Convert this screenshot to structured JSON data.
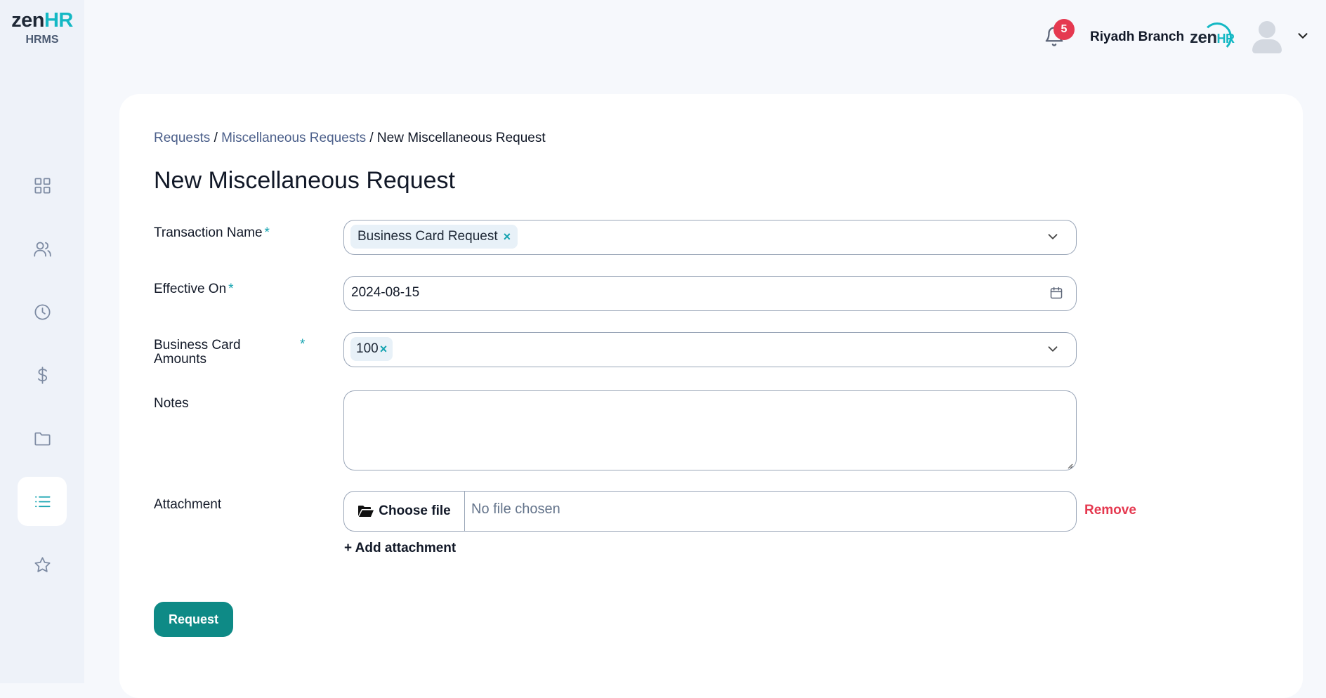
{
  "app": {
    "logo_zen": "zen",
    "logo_hr": "HR",
    "logo_sub": "HRMS"
  },
  "sidebar": {
    "items": [
      {
        "icon": "dashboard-grid-icon",
        "active": false
      },
      {
        "icon": "people-icon",
        "active": false
      },
      {
        "icon": "clock-icon",
        "active": false
      },
      {
        "icon": "dollar-icon",
        "active": false
      },
      {
        "icon": "folder-icon",
        "active": false
      },
      {
        "icon": "list-icon",
        "active": true
      },
      {
        "icon": "star-icon",
        "active": false
      }
    ]
  },
  "header": {
    "notification_count": "5",
    "branch": "Riyadh Branch",
    "company_logo_zen": "zen",
    "company_logo_hr": "HR"
  },
  "breadcrumb": {
    "items": [
      "Requests",
      "Miscellaneous Requests",
      "New Miscellaneous Request"
    ],
    "separator": "/"
  },
  "page_title": "New Miscellaneous Request",
  "form": {
    "transaction_name": {
      "label": "Transaction Name",
      "required": "*",
      "value": "Business Card Request",
      "remove": "×"
    },
    "effective_on": {
      "label": "Effective On",
      "required": "*",
      "value": "2024-08-15"
    },
    "business_card_amounts": {
      "label_line1": "Business Card",
      "label_line2": "Amounts",
      "required": "*",
      "value": "100",
      "remove": "×"
    },
    "notes": {
      "label": "Notes",
      "value": ""
    },
    "attachment": {
      "label": "Attachment",
      "choose_label": "Choose file",
      "status": "No file chosen",
      "remove_label": "Remove",
      "add_label": "+ Add attachment"
    },
    "submit_label": "Request"
  },
  "colors": {
    "accent": "#14a3b0",
    "primary_button": "#0e8a86",
    "danger": "#e53950",
    "sidebar_bg": "#eef2f9",
    "page_bg": "#f6f8fc"
  }
}
